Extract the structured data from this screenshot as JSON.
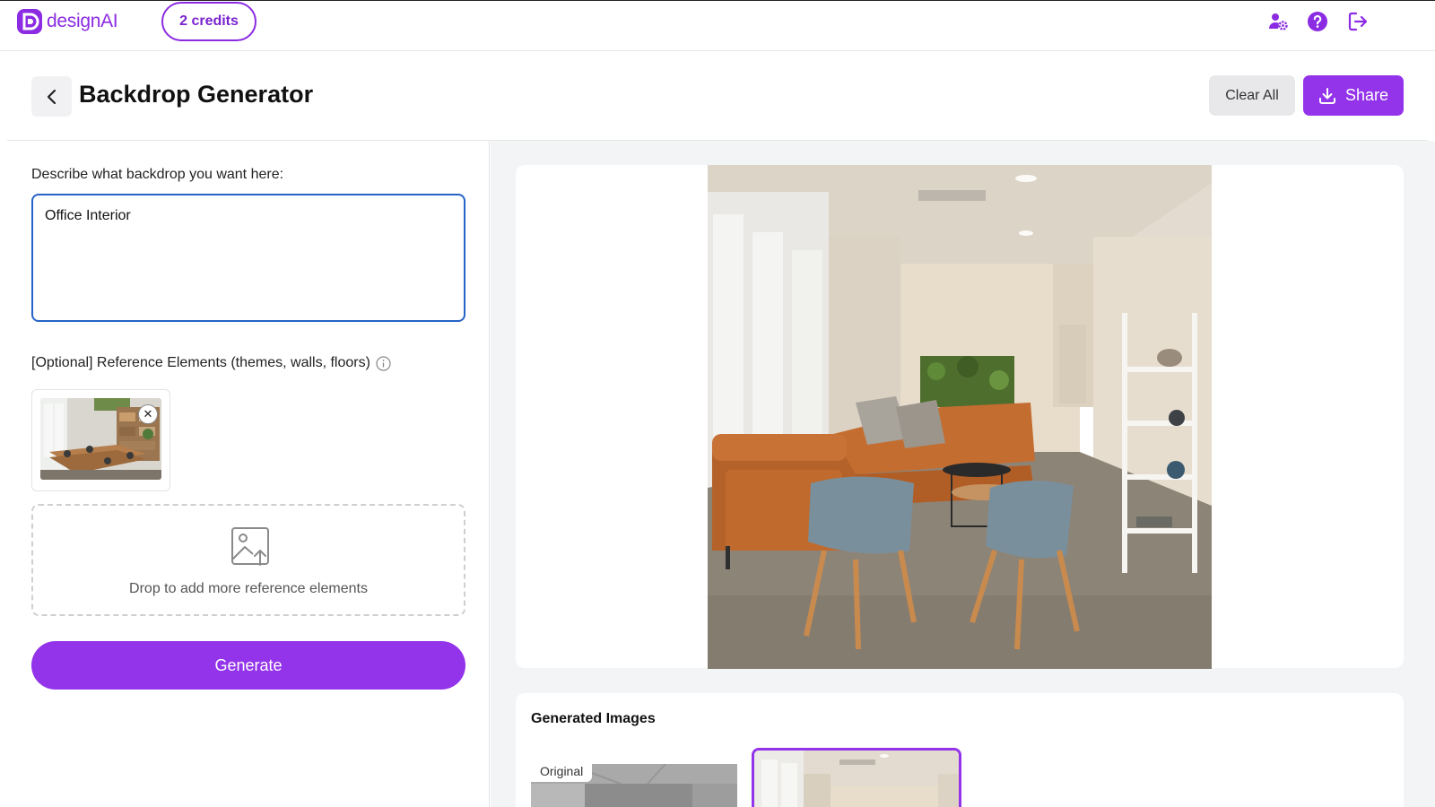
{
  "app": {
    "logo_text": "designAI",
    "credits_label": "2 credits",
    "brand_color": "#9333ea"
  },
  "top_icons": [
    "user-settings-icon",
    "help-icon",
    "logout-icon"
  ],
  "header": {
    "title": "Backdrop Generator",
    "clear_label": "Clear All",
    "share_label": "Share"
  },
  "form": {
    "describe_label": "Describe what backdrop you want here:",
    "describe_value": "Office Interior",
    "reference_label": "[Optional] Reference Elements (themes, walls, floors)",
    "drop_text": "Drop to add more reference elements",
    "generate_label": "Generate"
  },
  "gallery": {
    "title": "Generated Images",
    "original_badge": "Original"
  }
}
